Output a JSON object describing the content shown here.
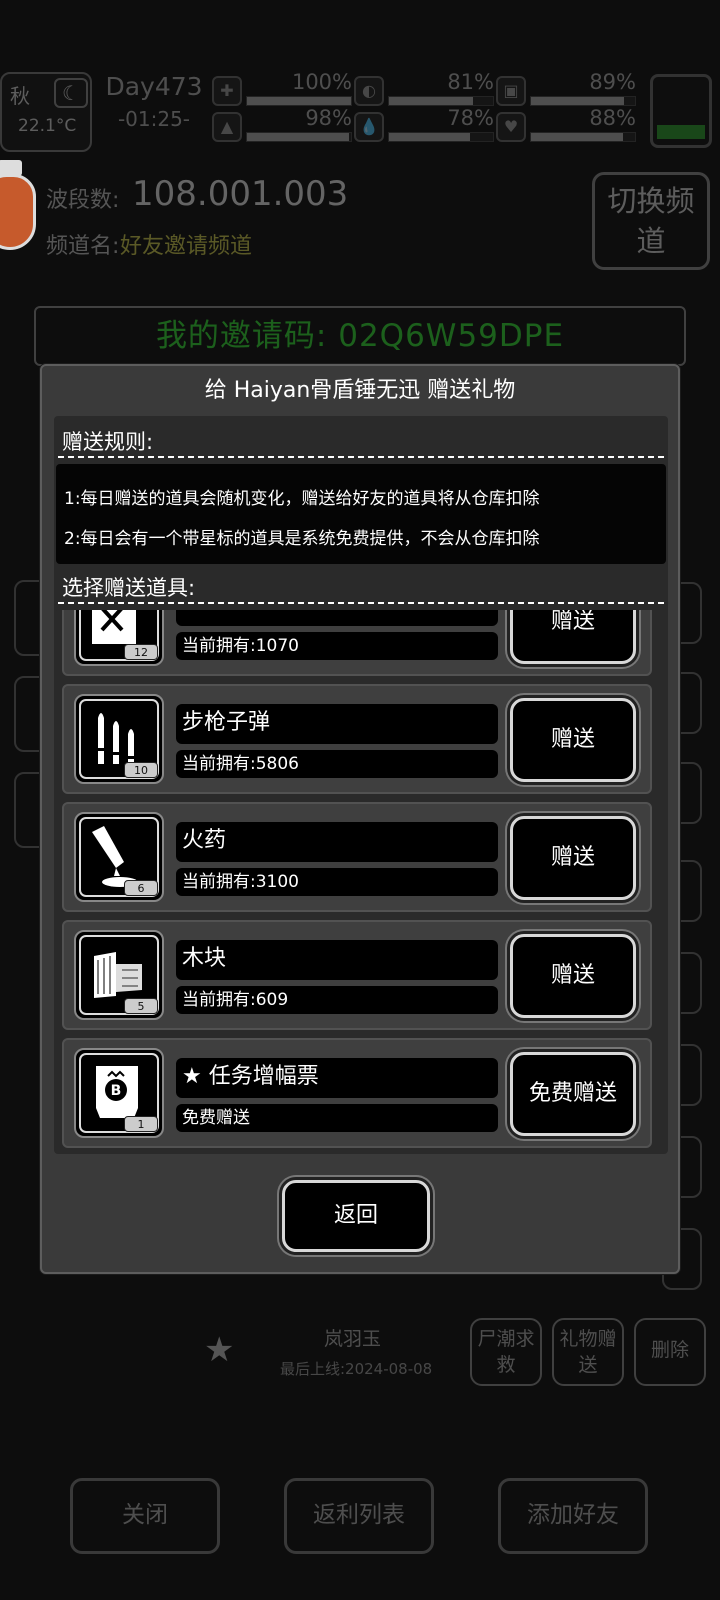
{
  "hud": {
    "season": "秋",
    "moon_icon": "moon-icon",
    "temperature": "22.1°C",
    "day": "Day473",
    "clock": "-01:25-",
    "stats": [
      {
        "icon": "medkit-icon",
        "glyph": "✚",
        "value": "100%",
        "level": 1.0
      },
      {
        "icon": "stomach-icon",
        "glyph": "◐",
        "value": "81%",
        "level": 0.81
      },
      {
        "icon": "shield-icon",
        "glyph": "▣",
        "value": "89%",
        "level": 0.89
      },
      {
        "icon": "boot-icon",
        "glyph": "▲",
        "value": "98%",
        "level": 0.98
      },
      {
        "icon": "water-drop-icon",
        "glyph": "💧",
        "value": "78%",
        "level": 0.78
      },
      {
        "icon": "heart-icon",
        "glyph": "♥",
        "value": "88%",
        "level": 0.88
      }
    ]
  },
  "radio": {
    "freq_label": "波段数:",
    "freq_value": "108.001.003",
    "channel_label": "频道名:",
    "channel_value": "好友邀请频道",
    "switch_label": "切换频道"
  },
  "invite": {
    "text": "我的邀请码: 02Q6W59DPE"
  },
  "bg_friend": {
    "name": "岚羽玉",
    "last_online": "最后上线:2024-08-08",
    "btn_rescue": "尸潮求救",
    "btn_gift": "礼物赠送",
    "btn_delete": "删除"
  },
  "bottom": {
    "close": "关闭",
    "rebate": "返利列表",
    "add_friend": "添加好友"
  },
  "modal": {
    "title": "给 Haiyan骨盾锤无迅 赠送礼物",
    "rules_label": "赠送规则:",
    "rules": [
      "1:每日赠送的道具会随机变化，赠送给好友的道具将从仓库扣除",
      "2:每日会有一个带星标的道具是系统免费提供，不会从仓库扣除"
    ],
    "select_label": "选择赠送道具:",
    "items": [
      {
        "name": "",
        "owned": "当前拥有:1070",
        "count": "12",
        "button": "赠送",
        "icon": "crossed-sheet-icon"
      },
      {
        "name": "步枪子弹",
        "owned": "当前拥有:5806",
        "count": "10",
        "button": "赠送",
        "icon": "rifle-bullets-icon"
      },
      {
        "name": "火药",
        "owned": "当前拥有:3100",
        "count": "6",
        "button": "赠送",
        "icon": "gunpowder-icon"
      },
      {
        "name": "木块",
        "owned": "当前拥有:609",
        "count": "5",
        "button": "赠送",
        "icon": "wood-block-icon"
      },
      {
        "name": "★ 任务增幅票",
        "owned": "免费赠送",
        "count": "1",
        "button": "免费赠送",
        "icon": "mission-ticket-icon"
      }
    ],
    "back_label": "返回"
  }
}
